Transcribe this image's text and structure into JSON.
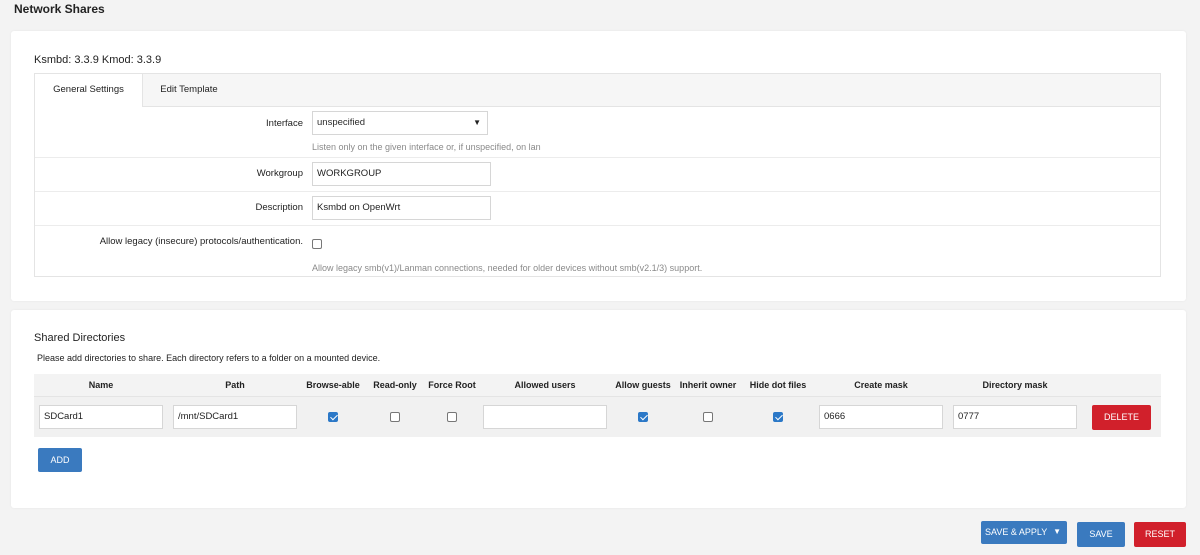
{
  "page": {
    "title": "Network Shares"
  },
  "settings": {
    "version_text": "Ksmbd: 3.3.9 Kmod: 3.3.9",
    "tabs": [
      "General Settings",
      "Edit Template"
    ],
    "interface": {
      "label": "Interface",
      "value": "unspecified",
      "help": "Listen only on the given interface or, if unspecified, on lan"
    },
    "workgroup": {
      "label": "Workgroup",
      "value": "WORKGROUP"
    },
    "description": {
      "label": "Description",
      "value": "Ksmbd on OpenWrt"
    },
    "legacy": {
      "label": "Allow legacy (insecure) protocols/authentication.",
      "checked": false,
      "help": "Allow legacy smb(v1)/Lanman connections, needed for older devices without smb(v2.1/3) support."
    }
  },
  "shares": {
    "title": "Shared Directories",
    "description": "Please add directories to share. Each directory refers to a folder on a mounted device.",
    "columns": [
      "Name",
      "Path",
      "Browse-able",
      "Read-only",
      "Force Root",
      "Allowed users",
      "Allow guests",
      "Inherit owner",
      "Hide dot files",
      "Create mask",
      "Directory mask"
    ],
    "rows": [
      {
        "name": "SDCard1",
        "path": "/mnt/SDCard1",
        "browseable": true,
        "readonly": false,
        "force_root": false,
        "allowed_users": "",
        "allow_guests": true,
        "inherit_owner": false,
        "hide_dot_files": true,
        "create_mask": "0666",
        "directory_mask": "0777"
      }
    ],
    "delete_label": "DELETE",
    "add_label": "ADD"
  },
  "footer": {
    "save_apply_label": "SAVE & APPLY",
    "save_label": "SAVE",
    "reset_label": "RESET"
  },
  "colors": {
    "primary": "#3a7abf",
    "danger": "#d1202b",
    "checked": "#2b78c7"
  }
}
